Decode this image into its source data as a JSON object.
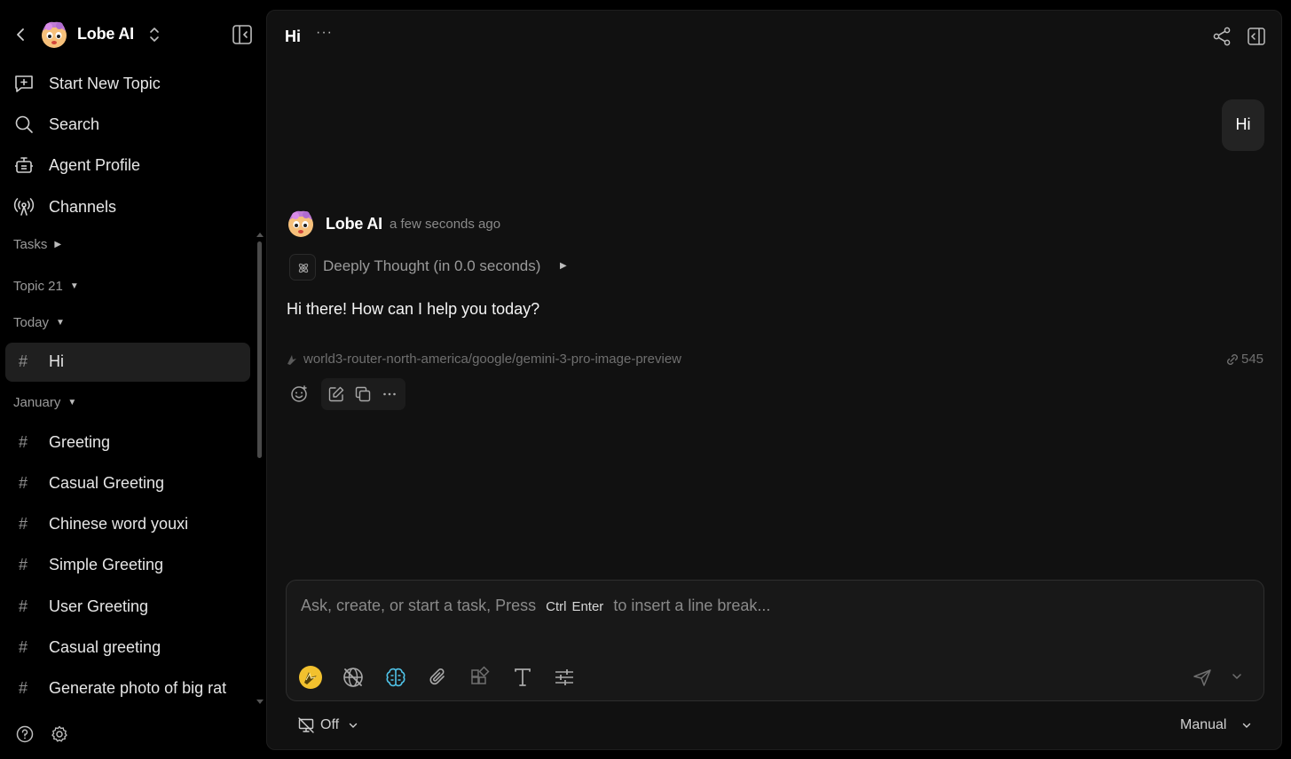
{
  "sidebar": {
    "agent_name": "Lobe AI",
    "nav": [
      {
        "label": "Start New Topic",
        "icon": "new-topic-icon"
      },
      {
        "label": "Search",
        "icon": "search-icon"
      },
      {
        "label": "Agent Profile",
        "icon": "robot-icon"
      },
      {
        "label": "Channels",
        "icon": "broadcast-icon"
      }
    ],
    "groups": {
      "tasks": "Tasks",
      "topic": "Topic 21",
      "today": "Today",
      "january": "January"
    },
    "today_topics": [
      {
        "label": "Hi",
        "active": true
      }
    ],
    "january_topics": [
      {
        "label": "Greeting"
      },
      {
        "label": "Casual Greeting"
      },
      {
        "label": "Chinese word youxi"
      },
      {
        "label": "Simple Greeting"
      },
      {
        "label": "User Greeting"
      },
      {
        "label": "Casual greeting"
      },
      {
        "label": "Generate photo of big rat"
      }
    ],
    "hash": "#"
  },
  "main": {
    "title": "Hi",
    "more": "···",
    "user_message": "Hi",
    "assistant": {
      "name": "Lobe AI",
      "time": "a few seconds ago",
      "thought": "Deeply Thought (in 0.0 seconds)",
      "reply": "Hi there! How can I help you today?",
      "model": "world3-router-north-america/google/gemini-3-pro-image-preview",
      "tokens": "545"
    },
    "composer": {
      "placeholder_pre": "Ask, create, or start a task, Press",
      "key1": "Ctrl",
      "key2": "Enter",
      "placeholder_post": "to insert a line break..."
    },
    "footer": {
      "left_label": "Off",
      "right_label": "Manual"
    }
  },
  "colors": {
    "background": "#000000",
    "panel": "#111111",
    "active_item": "#1f1f1f",
    "text": "#e8e8e8",
    "muted": "#8a8a8a",
    "accent_brain": "#4fc3e8"
  }
}
